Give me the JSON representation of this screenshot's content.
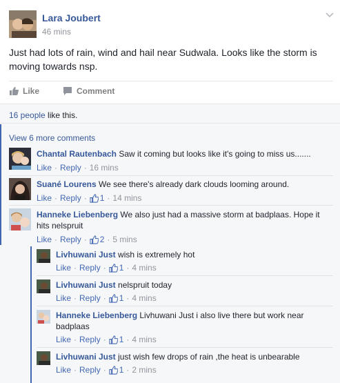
{
  "post": {
    "author": "Lara Joubert",
    "time": "46 mins",
    "text": "Just had lots of rain, wind and hail near Sudwala. Looks like the storm is moving towards nsp.",
    "like_label": "Like",
    "comment_label": "Comment",
    "likes_count_link": "16 people",
    "likes_count_suffix": " like this.",
    "view_more": "View 6 more comments"
  },
  "comments": [
    {
      "name": "Chantal Rautenbach",
      "text": "Saw it coming but looks like it's going to miss us.......",
      "like": "Like",
      "reply": "Reply",
      "time": "16 mins",
      "reactions": ""
    },
    {
      "name": "Suané Lourens",
      "text": "We see there's already dark clouds looming around.",
      "like": "Like",
      "reply": "Reply",
      "time": "14 mins",
      "reactions": "1"
    },
    {
      "name": "Hanneke Liebenberg",
      "text": "We also just had a massive storm at badplaas. Hope it hits nelspruit",
      "like": "Like",
      "reply": "Reply",
      "time": "5 mins",
      "reactions": "2"
    }
  ],
  "replies": [
    {
      "name": "Livhuwani Just",
      "text": "wish is extremely hot",
      "like": "Like",
      "reply": "Reply",
      "time": "4 mins",
      "reactions": "1"
    },
    {
      "name": "Livhuwani Just",
      "text": "nelspruit today",
      "like": "Like",
      "reply": "Reply",
      "time": "4 mins",
      "reactions": "1"
    },
    {
      "name": "Hanneke Liebenberg",
      "text": "Livhuwani Just i also live there but work near badplaas",
      "like": "Like",
      "reply": "Reply",
      "time": "4 mins",
      "reactions": "1"
    },
    {
      "name": "Livhuwani Just",
      "text": "just wish few drops of rain ,the heat is unbearable",
      "like": "Like",
      "reply": "Reply",
      "time": "2 mins",
      "reactions": "1"
    }
  ],
  "colors": {
    "link": "#365899",
    "accent": "#4267b2",
    "meta": "#90949c",
    "bg_comments": "#f6f7f9"
  }
}
